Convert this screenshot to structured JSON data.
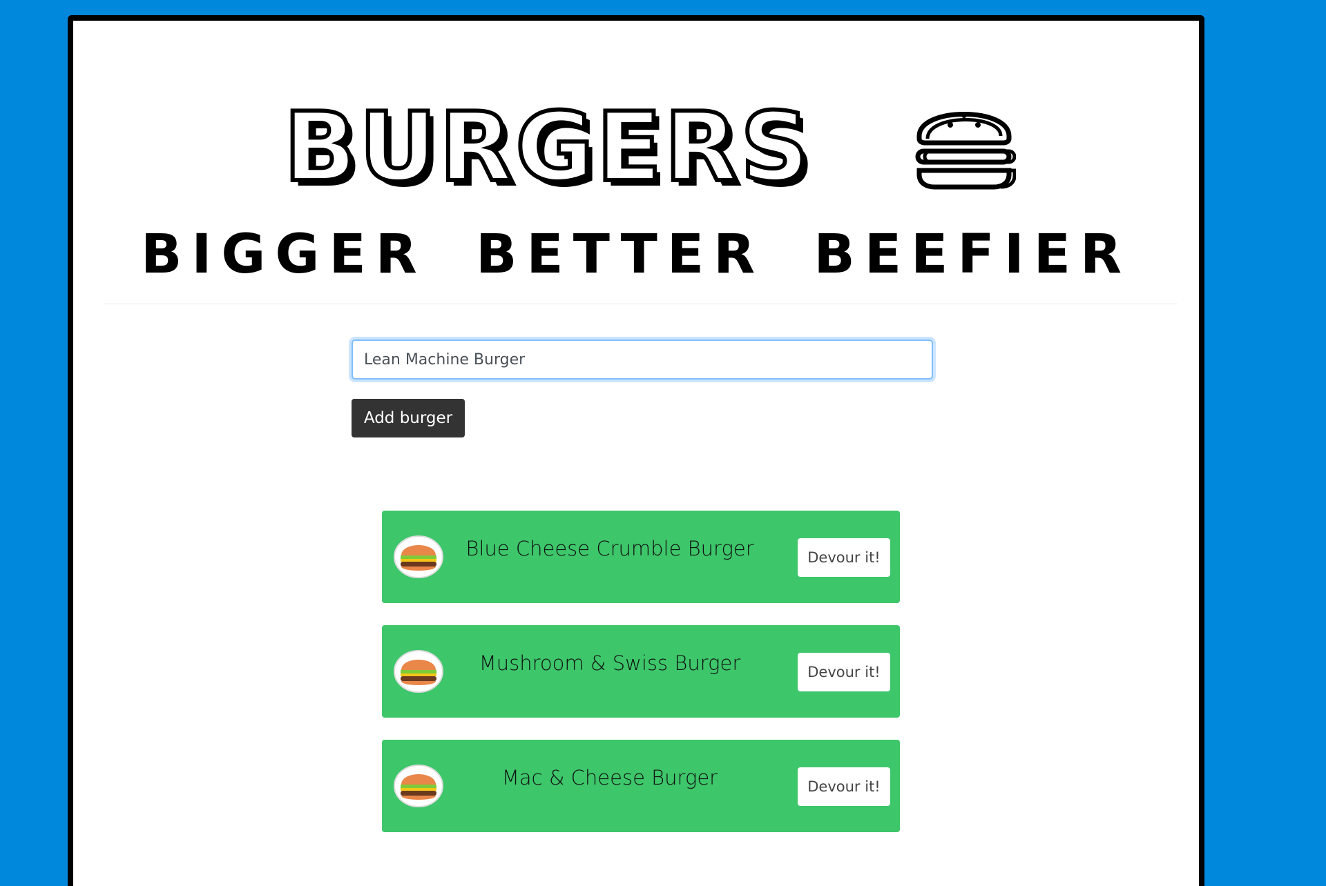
{
  "header": {
    "title": "BURGERS",
    "tagline": "BIGGER BETTER BEEFIER",
    "logo_icon": "hamburger-icon"
  },
  "form": {
    "input_value": "Lean Machine Burger",
    "add_button_label": "Add burger"
  },
  "burgers": [
    {
      "name": "Blue Cheese Crumble Burger",
      "button_label": "Devour it!",
      "icon": "burger-plate-icon"
    },
    {
      "name": "Mushroom & Swiss Burger",
      "button_label": "Devour it!",
      "icon": "burger-plate-icon"
    },
    {
      "name": "Mac & Cheese Burger",
      "button_label": "Devour it!",
      "icon": "burger-plate-icon"
    }
  ],
  "colors": {
    "page_background": "#0088dd",
    "card_background": "#3dc66a",
    "button_dark": "#333333"
  }
}
